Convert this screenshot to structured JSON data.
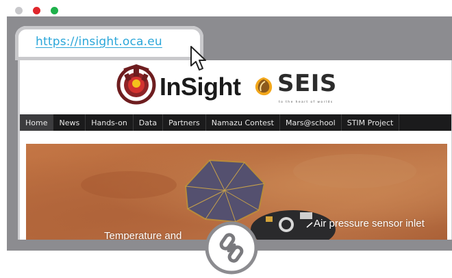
{
  "window": {
    "controls": [
      "window-control-1",
      "window-control-2",
      "window-control-3"
    ]
  },
  "address_bar": {
    "url": "https://insight.oca.eu"
  },
  "site": {
    "logo_insight": "InSight",
    "logo_seis": "SEIS",
    "logo_seis_tagline": "to the heart of worlds",
    "nav": [
      {
        "label": "Home",
        "active": true
      },
      {
        "label": "News"
      },
      {
        "label": "Hands-on"
      },
      {
        "label": "Data"
      },
      {
        "label": "Partners"
      },
      {
        "label": "Namazu Contest"
      },
      {
        "label": "Mars@school"
      },
      {
        "label": "STIM Project"
      }
    ]
  },
  "hero": {
    "label_1": "Air pressure sensor inlet",
    "label_2": "Temperature and"
  },
  "colors": {
    "url_link": "#2aa6d9",
    "nav_bg": "#1b1b1c",
    "frame": "#8c8c90"
  }
}
